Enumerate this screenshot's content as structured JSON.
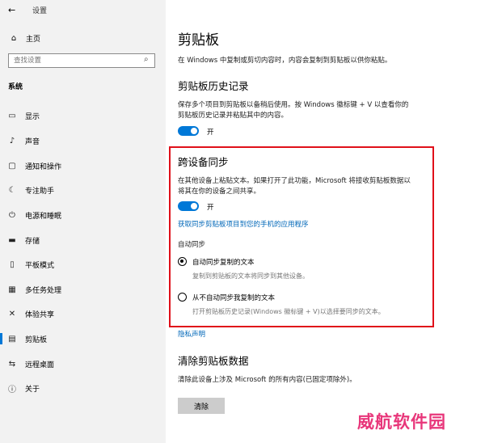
{
  "window": {
    "back_icon": "←",
    "title": "设置"
  },
  "sidebar": {
    "home": {
      "icon": "⌂",
      "label": "主页"
    },
    "search_placeholder": "查找设置",
    "search_icon": "⌕",
    "group_label": "系统",
    "items": [
      {
        "icon": "▭",
        "label": "显示"
      },
      {
        "icon": "♪",
        "label": "声音"
      },
      {
        "icon": "▢",
        "label": "通知和操作"
      },
      {
        "icon": "☾",
        "label": "专注助手"
      },
      {
        "icon": "⏻",
        "label": "电源和睡眠"
      },
      {
        "icon": "▬",
        "label": "存储"
      },
      {
        "icon": "▯",
        "label": "平板模式"
      },
      {
        "icon": "▦",
        "label": "多任务处理"
      },
      {
        "icon": "✕",
        "label": "体验共享"
      },
      {
        "icon": "▤",
        "label": "剪贴板"
      },
      {
        "icon": "⇆",
        "label": "远程桌面"
      },
      {
        "icon": "ⓘ",
        "label": "关于"
      }
    ],
    "selected_index": 9
  },
  "main": {
    "title": "剪贴板",
    "description": "在 Windows 中复制或剪切内容时，内容会复制到剪贴板以供你粘贴。",
    "history": {
      "heading": "剪贴板历史记录",
      "text": "保存多个项目到剪贴板以备稍后使用。按 Windows 徽标键 + V 以查看你的剪贴板历史记录并粘贴其中的内容。",
      "toggle_label": "开"
    },
    "sync": {
      "heading": "跨设备同步",
      "text": "在其他设备上粘贴文本。如果打开了此功能，Microsoft 将接收剪贴板数据以将其在你的设备之间共享。",
      "toggle_label": "开",
      "link": "获取同步剪贴板项目到您的手机的应用程序",
      "auto_sync_label": "自动同步",
      "options": [
        {
          "label": "自动同步复制的文本",
          "desc": "复制到剪贴板的文本将同步到其他设备。",
          "selected": true
        },
        {
          "label": "从不自动同步我复制的文本",
          "desc": "打开剪贴板历史记录(Windows 徽标键 + V)以选择要同步的文本。",
          "selected": false
        }
      ]
    },
    "privacy_link": "隐私声明",
    "clear": {
      "heading": "清除剪贴板数据",
      "text": "清除此设备上涉及 Microsoft 的所有内容(已固定项除外)。",
      "button": "清除"
    }
  },
  "watermark": "威航软件园",
  "colors": {
    "accent": "#0078d7",
    "link": "#0067b8",
    "highlight": "#e0101a"
  }
}
